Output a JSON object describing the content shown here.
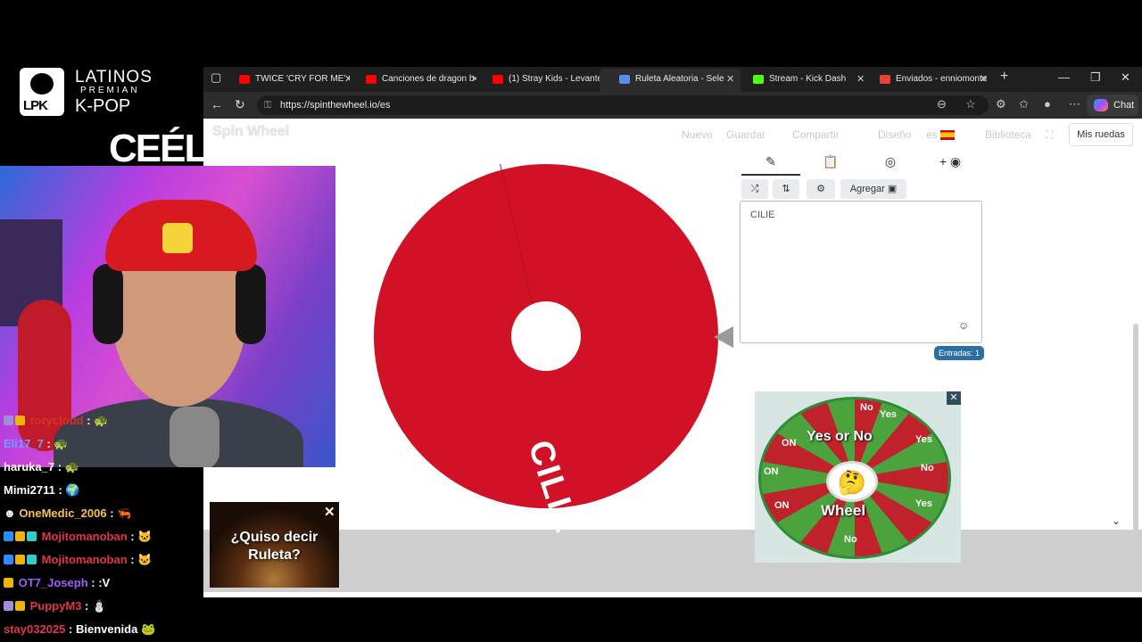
{
  "stream": {
    "brand_line1": "LATINOS",
    "brand_line2": "PREMIAN",
    "brand_line3": "K-POP",
    "logo_text": "LPK",
    "overlay_name": "CEÉL"
  },
  "browser": {
    "tabs": [
      {
        "label": "TWICE 'CRY FOR ME' C",
        "color": "#ff0000"
      },
      {
        "label": "Canciones de dragon b",
        "color": "#ff0000"
      },
      {
        "label": "(1) Stray Kids - Levante",
        "color": "#ff0000"
      },
      {
        "label": "Ruleta Aleatoria - Sele",
        "color": "#5b8def"
      },
      {
        "label": "Stream - Kick Dash",
        "color": "#53fc18"
      },
      {
        "label": "Enviados - enniomonte",
        "color": "#ea4335"
      }
    ],
    "url": "https://spinthewheel.io/es",
    "chat_label": "Chat"
  },
  "page": {
    "logo": "Spin Wheel",
    "nav": [
      "Nuevo",
      "Guardar",
      "Compartir",
      "Diseño",
      "es",
      "Biblioteca"
    ],
    "my_wheels": "Mis ruedas",
    "wheel_entry": "CILIE",
    "entries_text": "CILIE",
    "add_button": "Agregar",
    "entries_count": "Entradas: 1",
    "ad_title": "Yes or No",
    "ad_subtitle": "Wheel",
    "ad_words": [
      "Yes",
      "No"
    ]
  },
  "chat": [
    {
      "user": "rorycloud",
      "color": "#d6332a",
      "msg": ""
    },
    {
      "user": "Eli17_7",
      "color": "#6aa0ff",
      "msg": ""
    },
    {
      "user": "haruka_7",
      "color": "#ffffff",
      "msg": ""
    },
    {
      "user": "Mimi2711",
      "color": "#ffffff",
      "msg": ""
    },
    {
      "user": "OneMedic_2006",
      "color": "#f5c542",
      "msg": ""
    },
    {
      "user": "Mojitomanoban",
      "color": "#e0364a",
      "msg": ""
    },
    {
      "user": "Mojitomanoban",
      "color": "#e0364a",
      "msg": ""
    },
    {
      "user": "OT7_Joseph",
      "color": "#a35bff",
      "msg": ":V"
    },
    {
      "user": "PuppyM3",
      "color": "#e0364a",
      "msg": ""
    },
    {
      "user": "stay032025",
      "color": "#e0364a",
      "msg": "Bienvenida"
    }
  ],
  "roulette_ad": {
    "line1": "¿Quiso decir",
    "line2": "Ruleta?"
  }
}
